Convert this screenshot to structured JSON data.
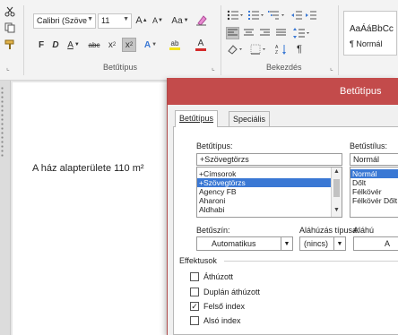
{
  "ribbon": {
    "font_name": "Calibri (Szöve",
    "font_size": "11",
    "grow_font": "A",
    "shrink_font": "A",
    "change_case": "Aa",
    "bold": "F",
    "italic": "D",
    "underline": "A",
    "strikethrough": "abc",
    "subscript": "x",
    "superscript": "x",
    "text_effects": "A",
    "highlight": "ab",
    "font_color": "A",
    "group_font_label": "Betűtípus",
    "group_paragraph_label": "Bekezdés",
    "style_preview": "AaÁáBbCc",
    "style_name": "¶ Normál",
    "pilcrow": "¶"
  },
  "document": {
    "text": "A ház alapterülete 110 m²"
  },
  "dialog": {
    "title": "Betűtípus",
    "tabs": [
      {
        "label": "Betűtípus",
        "active": true
      },
      {
        "label": "Speciális",
        "active": false
      }
    ],
    "font_label": "Betűtípus:",
    "font_value": "+Szövegtörzs",
    "font_list": [
      {
        "label": "+Címsorok",
        "selected": false
      },
      {
        "label": "+Szövegtörzs",
        "selected": true
      },
      {
        "label": "Agency FB",
        "selected": false
      },
      {
        "label": "Aharoni",
        "selected": false
      },
      {
        "label": "Aldhabi",
        "selected": false
      }
    ],
    "style_label": "Betűstílus:",
    "style_value": "Normál",
    "style_list": [
      {
        "label": "Normál",
        "selected": true
      },
      {
        "label": "Dőlt",
        "selected": false
      },
      {
        "label": "Félkövér",
        "selected": false
      },
      {
        "label": "Félkövér Dőlt",
        "selected": false
      }
    ],
    "color_label": "Betűszín:",
    "color_value": "Automatikus",
    "underline_label": "Aláhúzás típusa:",
    "underline_value": "(nincs)",
    "underline_color_label": "Aláhú",
    "underline_color_value": "A",
    "effects_label": "Effektusok",
    "effects": [
      {
        "label": "Áthúzott",
        "checked": false
      },
      {
        "label": "Duplán áthúzott",
        "checked": false
      },
      {
        "label": "Felső index",
        "checked": true
      },
      {
        "label": "Alsó index",
        "checked": false
      }
    ],
    "check_mark": "✓",
    "scroll_up": "▲",
    "scroll_down": "▼",
    "dropdown_arrow": "▼"
  },
  "colors": {
    "dialog_title_bg": "#c34b4b",
    "selection": "#3a78d4",
    "font_color_bar": "#d42b2b",
    "highlight_bar": "#f4e21a"
  },
  "icons": [
    "cut-icon",
    "copy-icon",
    "format-painter-icon",
    "clear-formatting-icon",
    "bullets-icon",
    "numbering-icon",
    "multilevel-list-icon",
    "decrease-indent-icon",
    "increase-indent-icon",
    "align-left-icon",
    "align-center-icon",
    "align-right-icon",
    "justify-icon",
    "line-spacing-icon",
    "shading-icon",
    "borders-icon",
    "sort-icon",
    "show-marks-icon",
    "dialog-launcher-icon",
    "checkbox-icon"
  ]
}
